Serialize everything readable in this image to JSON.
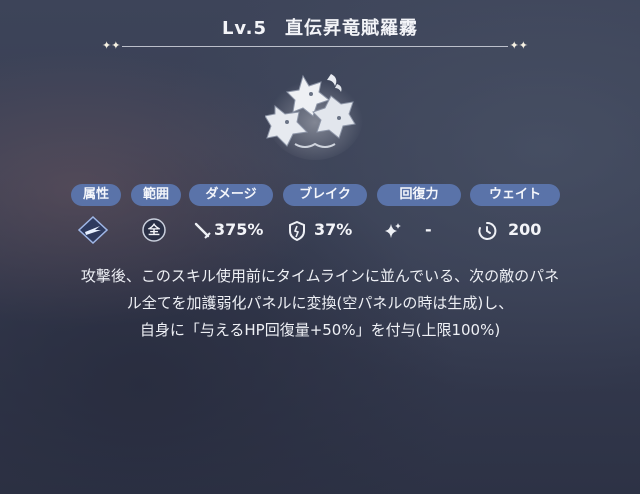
{
  "skill": {
    "level": "Lv.5",
    "name": "直伝昇竜賦羅霧"
  },
  "icons": {
    "skill": "dragon-heads-icon",
    "element": "wind-arrow-icon",
    "range": "range-all-icon",
    "damage": "sword-icon",
    "break": "shield-break-icon",
    "recovery": "sparkle-icon",
    "wait": "clock-icon"
  },
  "labels": {
    "element": "属性",
    "range": "範囲",
    "damage": "ダメージ",
    "break": "ブレイク",
    "recovery": "回復力",
    "wait": "ウェイト"
  },
  "values": {
    "range": "全",
    "damage": "375%",
    "break": "37%",
    "recovery": "-",
    "wait": "200"
  },
  "description": {
    "line1": "攻撃後、このスキル使用前にタイムラインに並んでいる、次の敵のパネ",
    "line2": "ル全てを加護弱化パネルに変換(空パネルの時は生成)し、",
    "line3": "自身に「与えるHP回復量+50%」を付与(上限100%)"
  },
  "colors": {
    "pill": "#5a73a9",
    "background": "#3a4156",
    "text": "#f1f3f8"
  }
}
